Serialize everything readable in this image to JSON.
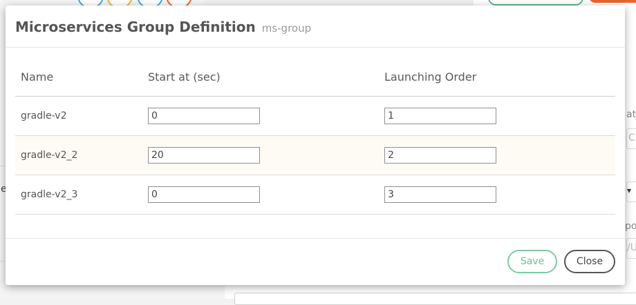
{
  "dialog": {
    "title": "Microservices Group Definition",
    "subtitle": "ms-group"
  },
  "table": {
    "columns": [
      "Name",
      "Start at (sec)",
      "Launching Order"
    ],
    "rows": [
      {
        "name": "gradle-v2",
        "start_at": "0",
        "order": "1"
      },
      {
        "name": "gradle-v2_2",
        "start_at": "20",
        "order": "2"
      },
      {
        "name": "gradle-v2_3",
        "start_at": "0",
        "order": "3"
      }
    ]
  },
  "footer": {
    "save_label": "Save",
    "close_label": "Close"
  },
  "background": {
    "text_at": "at",
    "text_c": "C:\\",
    "text_po": "po",
    "text_us": "/Us",
    "text_e": "e",
    "dropdown_arrow": "▾"
  },
  "colors": {
    "save_accent": "#7fc9a2",
    "alt_row": "#fdfbf4",
    "orange_button": "#e8652b",
    "green_button": "#5cb88a"
  }
}
